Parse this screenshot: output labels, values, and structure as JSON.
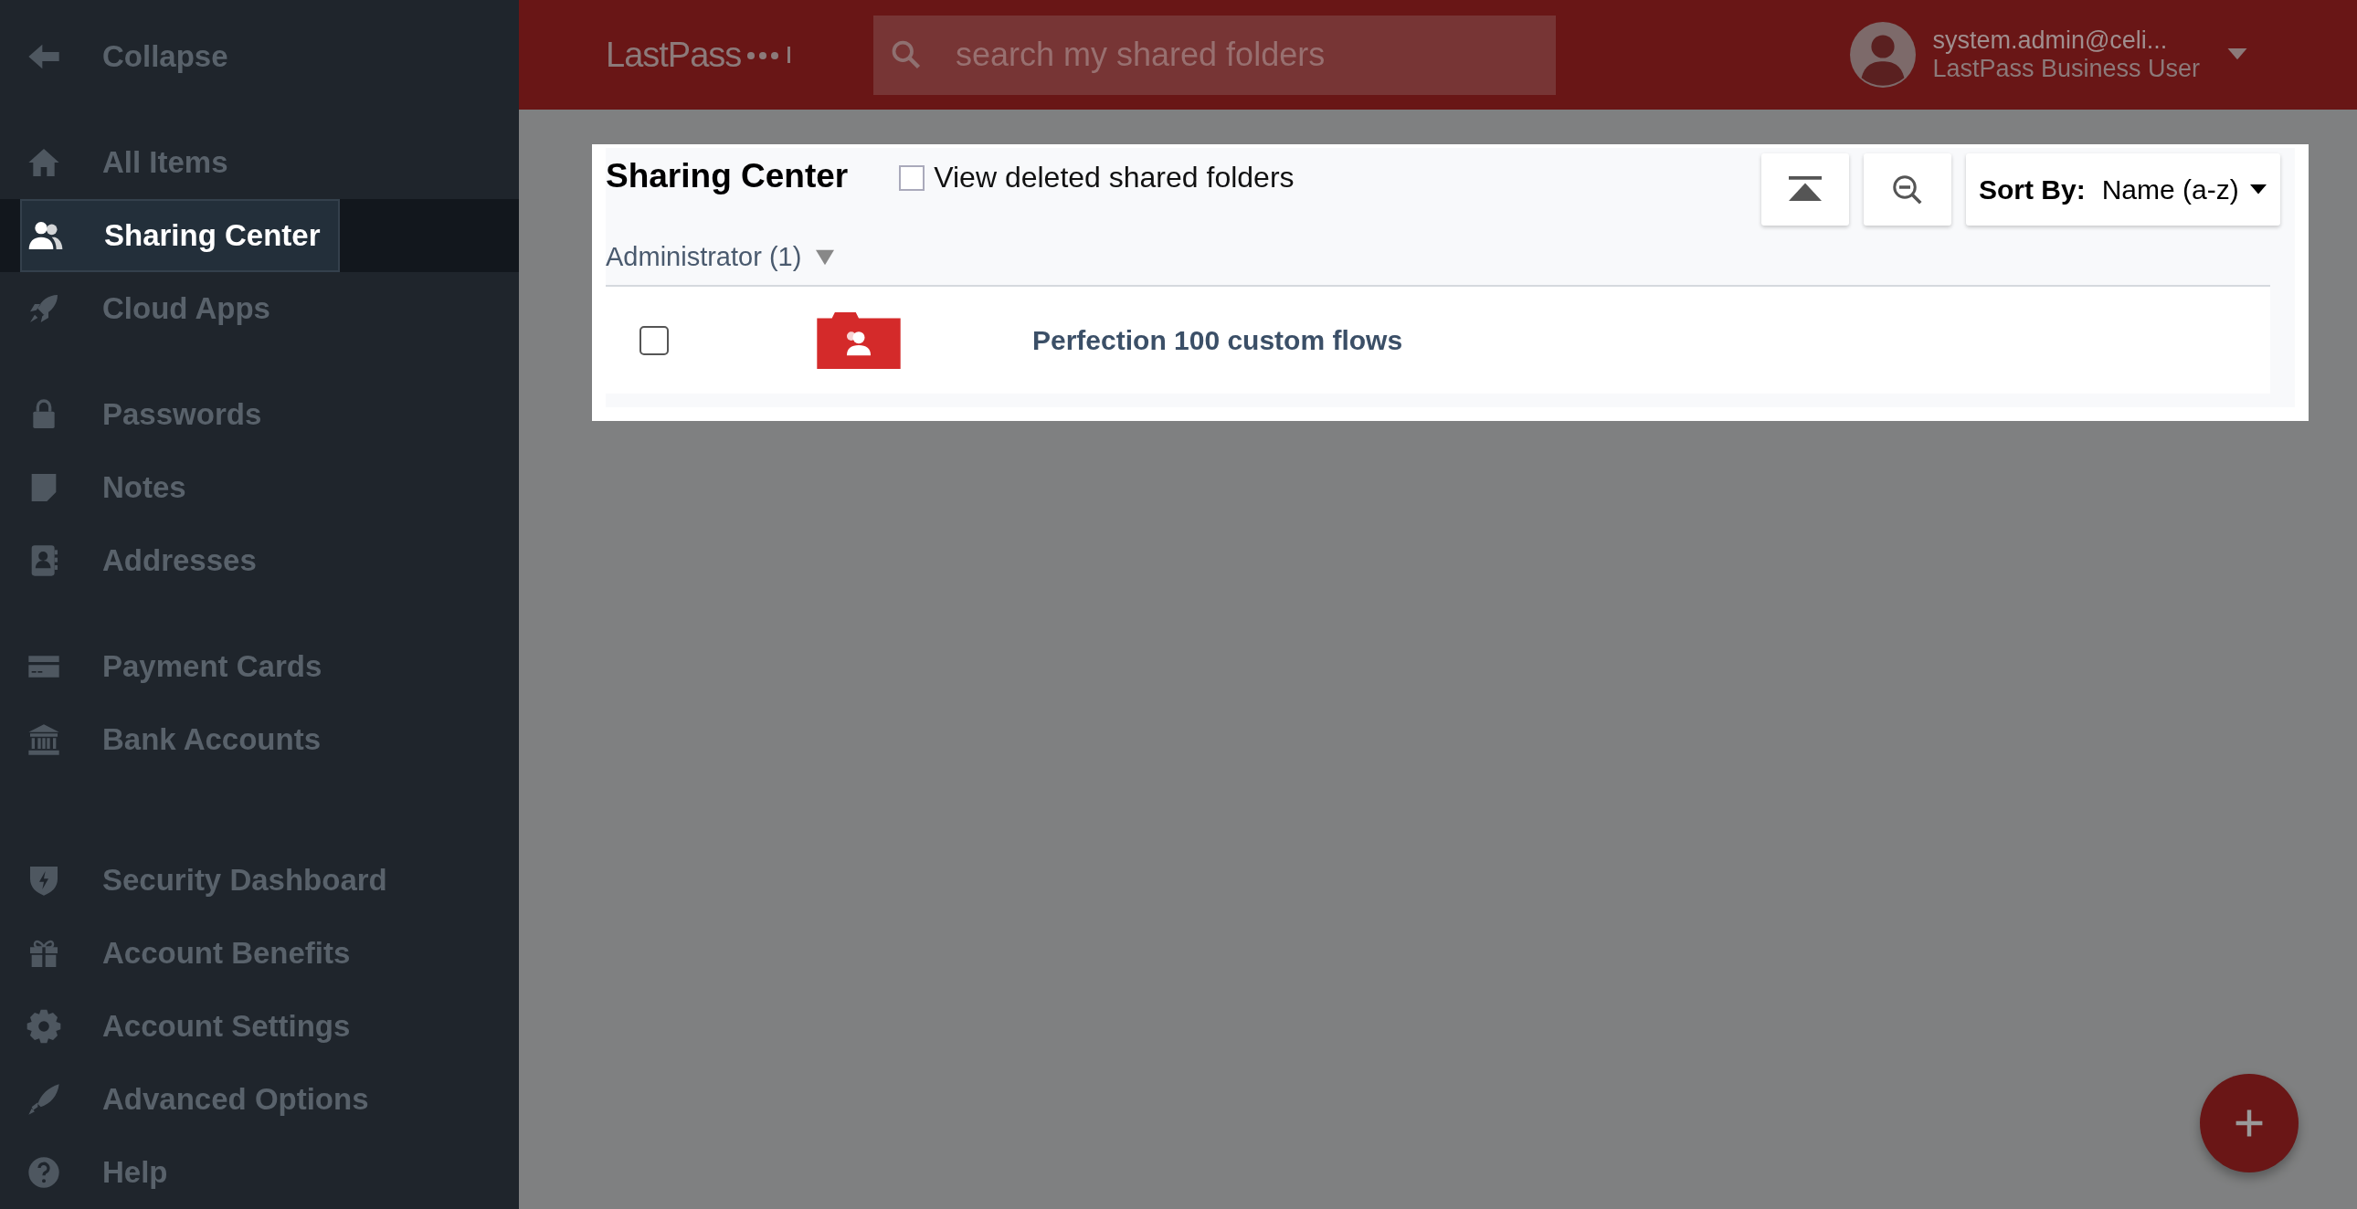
{
  "sidebar": {
    "collapse": {
      "label": "Collapse"
    },
    "groups": [
      {
        "items": [
          {
            "label": "All Items",
            "selected": false
          },
          {
            "label": "Sharing Center",
            "selected": true
          },
          {
            "label": "Cloud Apps",
            "selected": false
          }
        ]
      },
      {
        "items": [
          {
            "label": "Passwords",
            "selected": false
          },
          {
            "label": "Notes",
            "selected": false
          },
          {
            "label": "Addresses",
            "selected": false
          }
        ]
      },
      {
        "items": [
          {
            "label": "Payment Cards",
            "selected": false
          },
          {
            "label": "Bank Accounts",
            "selected": false
          }
        ]
      },
      {
        "items": [
          {
            "label": "Security Dashboard",
            "selected": false
          },
          {
            "label": "Account Benefits",
            "selected": false
          },
          {
            "label": "Account Settings",
            "selected": false
          },
          {
            "label": "Advanced Options",
            "selected": false
          },
          {
            "label": "Help",
            "selected": false
          }
        ]
      }
    ]
  },
  "header": {
    "logo": "LastPass",
    "search": {
      "placeholder": "search my shared folders"
    },
    "user": {
      "email": "system.admin@celi...",
      "role": "LastPass Business User"
    }
  },
  "panel": {
    "title": "Sharing Center",
    "view_deleted": {
      "label": "View deleted shared folders",
      "checked": false
    },
    "sort": {
      "label": "Sort By:",
      "value": "Name (a-z)"
    },
    "group": {
      "label": "Administrator (1)",
      "expanded": true,
      "rows": [
        {
          "name": "Perfection 100 custom flows",
          "checked": false
        }
      ]
    }
  }
}
